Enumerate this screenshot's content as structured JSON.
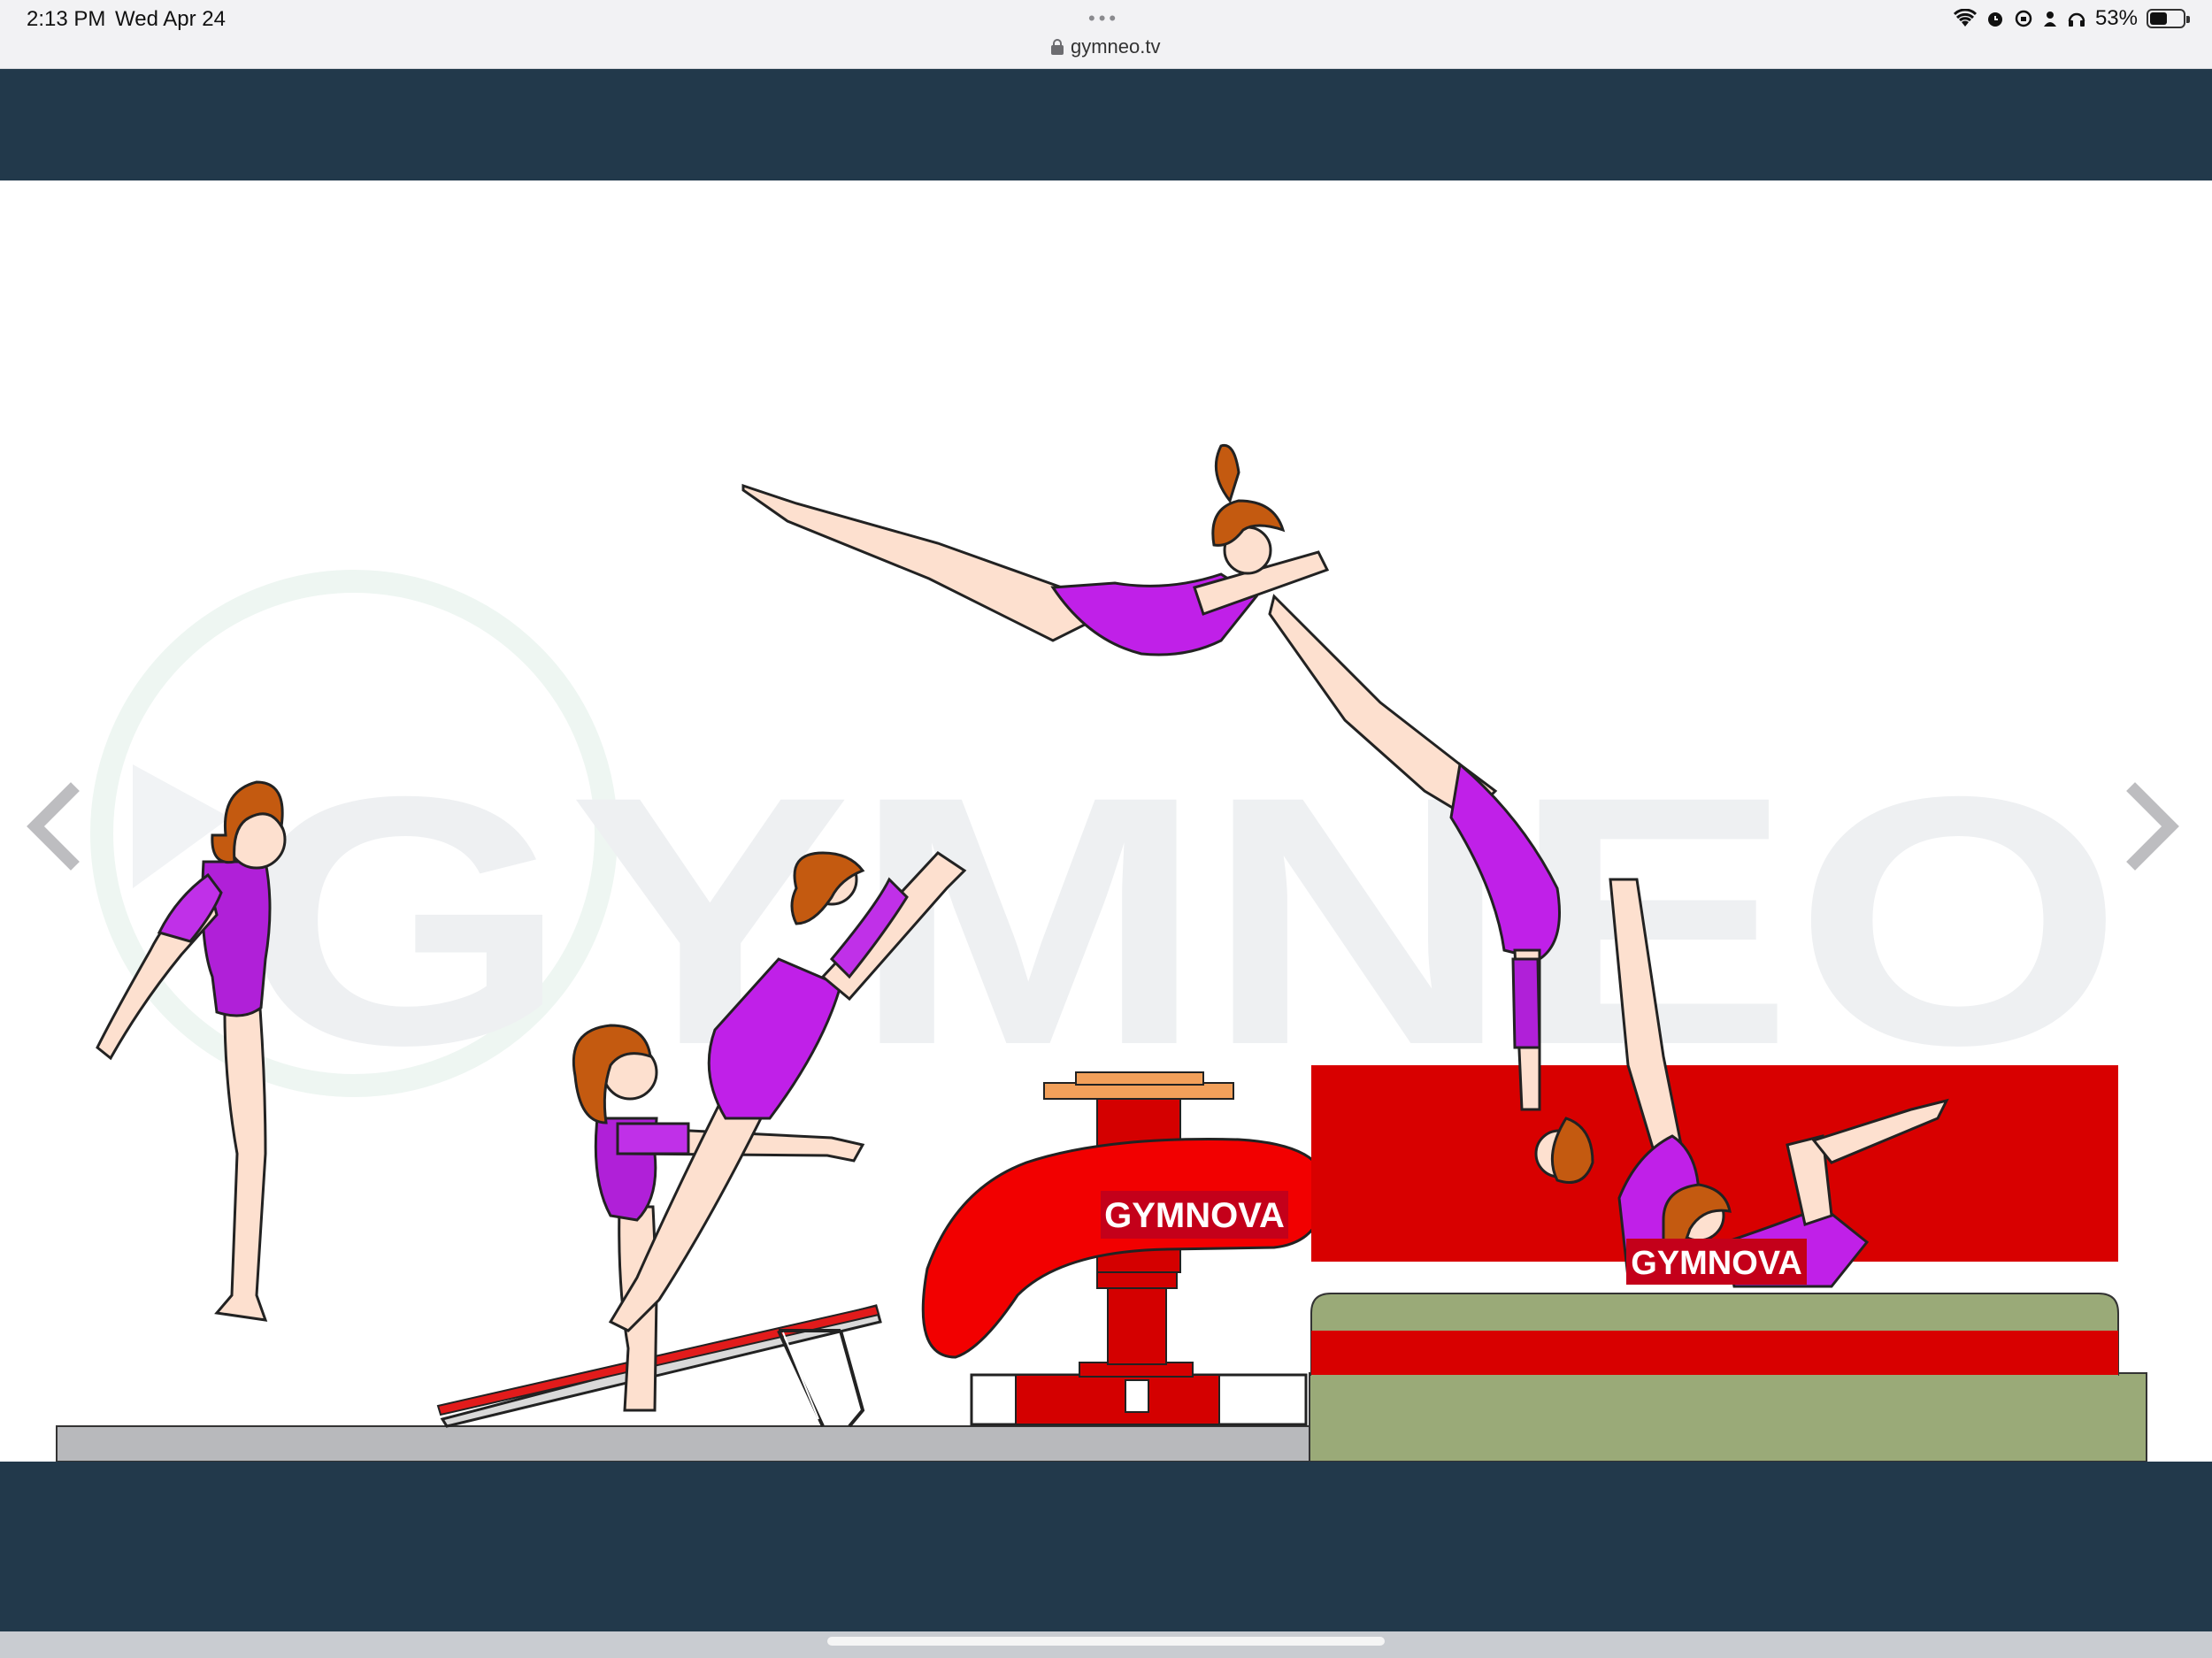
{
  "status_bar": {
    "time": "2:13 PM",
    "date": "Wed Apr 24",
    "battery_percent": "53%",
    "battery_level": 0.53,
    "icons": [
      "wifi-icon",
      "alarm-icon",
      "screen-rotation-lock-icon",
      "person-icon",
      "headphones-icon",
      "battery-icon"
    ]
  },
  "browser": {
    "url": "gymneo.tv",
    "menu_dots": "•••"
  },
  "colors": {
    "header_bg": "#22394b",
    "vault_red": "#e60000",
    "mat_green": "#9aaa78",
    "leotard_purple": "#b020d8",
    "watermark": "#eef0f2"
  },
  "illustration": {
    "watermark_text": "GYMNEO",
    "vault_brand": "GYMNOVA",
    "mat_brand": "GYMNOVA"
  },
  "navigation": {
    "prev": "chevron-left-icon",
    "next": "chevron-right-icon"
  }
}
